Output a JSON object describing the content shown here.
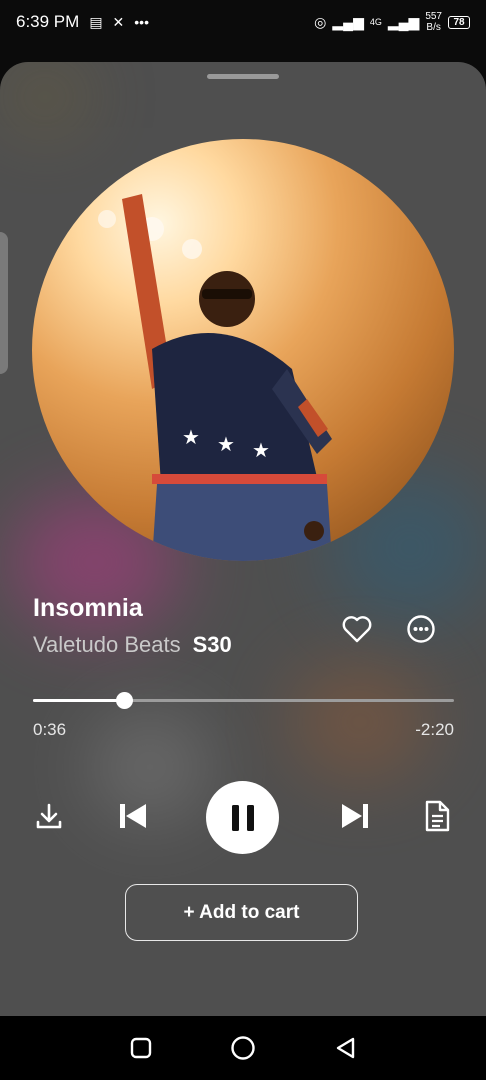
{
  "status_bar": {
    "time": "6:39 PM",
    "net_speed_value": "557",
    "net_speed_unit": "B/s",
    "signal_label": "4G",
    "battery": "78"
  },
  "player": {
    "title": "Insomnia",
    "artist": "Valetudo Beats",
    "code": "S30",
    "elapsed": "0:36",
    "remaining": "-2:20",
    "progress": 0.215,
    "add_to_cart": "+ Add to cart"
  },
  "icons": {
    "like": "heart-icon",
    "more": "more-horizontal-icon",
    "download": "download-icon",
    "previous": "skip-previous-icon",
    "pause": "pause-icon",
    "next": "skip-next-icon",
    "lyrics": "document-icon"
  },
  "colors": {
    "sheet": "#4f4f4f",
    "accent": "#ffffff"
  }
}
